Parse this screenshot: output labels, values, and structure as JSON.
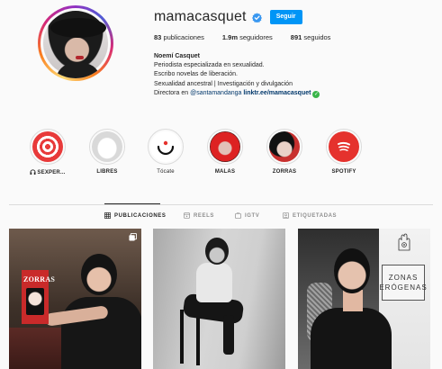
{
  "profile": {
    "username": "mamacasquet",
    "follow_label": "Seguir",
    "stats": [
      {
        "value": "83",
        "label": "publicaciones"
      },
      {
        "value": "1.9m",
        "label": "seguidores"
      },
      {
        "value": "891",
        "label": "seguidos"
      }
    ],
    "bio": {
      "name": "Noemí Casquet",
      "lines": [
        "Periodista especializada en sexualidad.",
        "Escribo novelas de liberación.",
        "Sexualidad ancestral | Investigación y divulgación"
      ],
      "directora_prefix": "Directora en",
      "mention": "@santamandanga",
      "link": "linktr.ee/mamacasquet"
    }
  },
  "highlights": [
    {
      "label": "SEXPER...",
      "icon": "headphones-icon"
    },
    {
      "label": "LIBRES"
    },
    {
      "label": "Tócate"
    },
    {
      "label": "MALAS"
    },
    {
      "label": "ZORRAS"
    },
    {
      "label": "SPOTIFY"
    }
  ],
  "tabs": [
    {
      "label": "PUBLICACIONES",
      "icon": "grid-icon",
      "active": true
    },
    {
      "label": "REELS",
      "icon": "reels-icon",
      "active": false
    },
    {
      "label": "IGTV",
      "icon": "igtv-icon",
      "active": false
    },
    {
      "label": "ETIQUETADAS",
      "icon": "tagged-icon",
      "active": false
    }
  ],
  "posts": [
    {
      "overlay_text": "ZORRAS",
      "icon": "multiple-posts-icon"
    },
    {},
    {
      "overlay_lines": [
        "ZONAS",
        "ERÓGENAS"
      ]
    }
  ],
  "colors": {
    "accent": "#0095f6",
    "verified": "#3897f0",
    "link_check": "#3ab54a",
    "spotify_bg": "#e5322d"
  }
}
